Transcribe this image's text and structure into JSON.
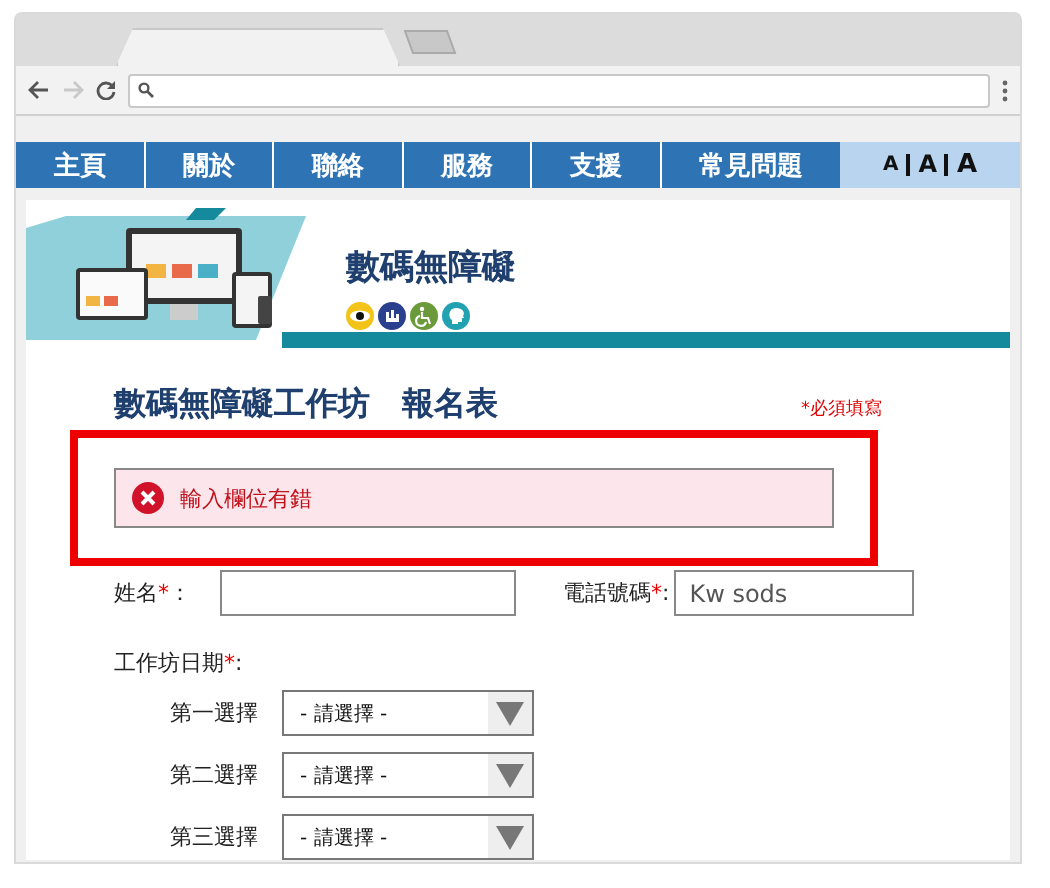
{
  "browser": {
    "forward_disabled": true
  },
  "nav": {
    "items": [
      {
        "label": "主頁"
      },
      {
        "label": "關於"
      },
      {
        "label": "聯絡"
      },
      {
        "label": "服務"
      },
      {
        "label": "支援"
      },
      {
        "label": "常見問題"
      }
    ],
    "font_sizes": [
      {
        "label": "A",
        "kind": "small"
      },
      {
        "label": "A",
        "kind": "medium"
      },
      {
        "label": "A",
        "kind": "large"
      }
    ]
  },
  "banner": {
    "title": "數碼無障礙"
  },
  "form": {
    "title": "數碼無障礙工作坊　報名表",
    "required_note": "*必須填寫",
    "error": {
      "message": "輸入欄位有錯"
    },
    "fields": [
      {
        "label": "姓名",
        "required_mark": "*",
        "colon": "："
      },
      {
        "label": "電話號碼",
        "required_mark": "*",
        "colon": ":",
        "value": "Kw sods"
      }
    ],
    "date_group": {
      "label": "工作坊日期",
      "required_mark": "*",
      "colon": ":"
    },
    "choices": [
      {
        "label": "第一選擇",
        "value": "- 請選擇 -"
      },
      {
        "label": "第二選擇",
        "value": "- 請選擇 -"
      },
      {
        "label": "第三選擇",
        "value": "- 請選擇 -"
      }
    ]
  }
}
